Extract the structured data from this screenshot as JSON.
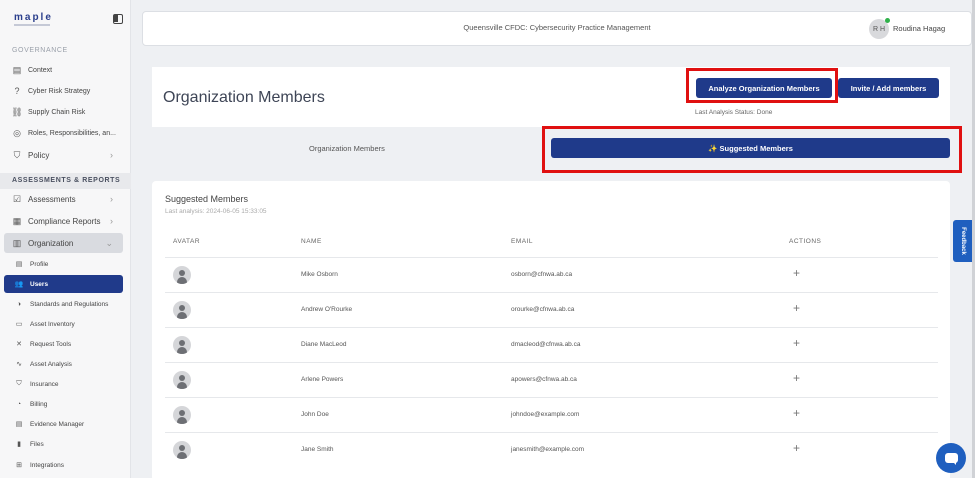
{
  "app": {
    "logo": "maple"
  },
  "sidebar": {
    "governance_label": "GOVERNANCE",
    "governance_items": [
      {
        "label": "Context",
        "icon": "document-icon"
      },
      {
        "label": "Cyber Risk Strategy",
        "icon": "question-icon"
      },
      {
        "label": "Supply Chain Risk",
        "icon": "chain-icon"
      },
      {
        "label": "Roles, Responsibilities, an...",
        "icon": "roles-icon"
      },
      {
        "label": "Policy",
        "icon": "shield-icon"
      }
    ],
    "assessments_label": "ASSESSMENTS & REPORTS",
    "assessment_items": [
      {
        "label": "Assessments",
        "icon": "check-doc-icon"
      },
      {
        "label": "Compliance Reports",
        "icon": "report-icon"
      },
      {
        "label": "Organization",
        "icon": "building-icon"
      }
    ],
    "org_items": [
      {
        "label": "Profile",
        "icon": "profile-icon"
      },
      {
        "label": "Users",
        "icon": "users-icon"
      },
      {
        "label": "Standards and Regulations",
        "icon": "scale-icon"
      },
      {
        "label": "Asset Inventory",
        "icon": "inventory-icon"
      },
      {
        "label": "Request Tools",
        "icon": "tools-icon"
      },
      {
        "label": "Asset Analysis",
        "icon": "analysis-icon"
      },
      {
        "label": "Insurance",
        "icon": "insurance-icon"
      },
      {
        "label": "Billing",
        "icon": "billing-icon"
      },
      {
        "label": "Evidence Manager",
        "icon": "evidence-icon"
      },
      {
        "label": "Files",
        "icon": "files-icon"
      },
      {
        "label": "Integrations",
        "icon": "integrations-icon"
      }
    ]
  },
  "topbar": {
    "title": "Queensville CFDC: Cybersecurity Practice Management",
    "user_initials": "R H",
    "user_name": "Roudina Hagag"
  },
  "header": {
    "title": "Organization Members",
    "analyze_button": "Analyze Organization Members",
    "invite_button": "Invite / Add members",
    "analysis_status": "Last Analysis Status: Done"
  },
  "tabs": {
    "org_members": "Organization Members",
    "suggested_members": "✨ Suggested Members"
  },
  "suggested": {
    "title": "Suggested Members",
    "last_analysis": "Last analysis: 2024-06-05 15:33:05",
    "columns": {
      "avatar": "AVATAR",
      "name": "NAME",
      "email": "EMAIL",
      "actions": "ACTIONS"
    },
    "rows": [
      {
        "name": "Mike Osborn",
        "email": "osborn@cfnwa.ab.ca"
      },
      {
        "name": "Andrew O'Rourke",
        "email": "orourke@cfnwa.ab.ca"
      },
      {
        "name": "Diane MacLeod",
        "email": "dmacleod@cfnwa.ab.ca"
      },
      {
        "name": "Arlene Powers",
        "email": "apowers@cfnwa.ab.ca"
      },
      {
        "name": "John Doe",
        "email": "johndoe@example.com"
      },
      {
        "name": "Jane Smith",
        "email": "janesmith@example.com"
      }
    ],
    "add_symbol": "+"
  },
  "feedback_label": "Feedback",
  "colors": {
    "primary": "#1f3a8a",
    "highlight": "#e01010",
    "chat": "#1f5fbf"
  }
}
